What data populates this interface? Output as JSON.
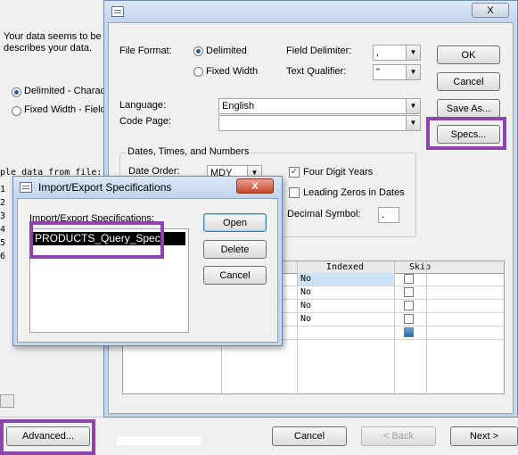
{
  "bg_wizard": {
    "description_lines": [
      "Your data seems to be i",
      "describes your data."
    ],
    "option_delimited": "Delimited - Characte",
    "option_fixed": "Fixed Width - Field",
    "sample_label": "ple data from file:",
    "row_numbers": [
      "1",
      "2",
      "3",
      "4",
      "5",
      "6"
    ],
    "advanced_label": "Advanced...",
    "cancel_label": "Cancel",
    "back_label": "< Back",
    "next_label": "Next >"
  },
  "spec_dialog": {
    "close_label": "X",
    "file_format_label": "File Format:",
    "format_delimited": "Delimited",
    "format_fixed": "Fixed Width",
    "field_delimiter_label": "Field Delimiter:",
    "field_delimiter_value": ",",
    "text_qualifier_label": "Text Qualifier:",
    "text_qualifier_value": "\"",
    "language_label": "Language:",
    "language_value": "English",
    "code_page_label": "Code Page:",
    "code_page_value": "",
    "ok_label": "OK",
    "cancel_label": "Cancel",
    "save_as_label": "Save As...",
    "specs_label": "Specs...",
    "dates_group_label": "Dates, Times, and Numbers",
    "date_order_label": "Date Order:",
    "date_order_value": "MDY",
    "four_digit_years": "Four Digit Years",
    "leading_zeros": "Leading Zeros in Dates",
    "decimal_symbol_label": "Decimal Symbol:",
    "decimal_symbol_value": ".",
    "grid_headers": [
      "Indexed",
      "Skip"
    ],
    "grid_rows": [
      {
        "indexed": "No",
        "skip": false
      },
      {
        "indexed": "No",
        "skip": false
      },
      {
        "indexed": "No",
        "skip": false
      },
      {
        "indexed": "No",
        "skip": false
      },
      {
        "indexed": "",
        "skip": true
      }
    ]
  },
  "ie_dialog": {
    "title": "Import/Export Specifications",
    "close_label": "X",
    "list_label": "Import/Export Specifications:",
    "items": [
      "PRODUCTS_Query_Spec"
    ],
    "open_label": "Open",
    "delete_label": "Delete",
    "cancel_label": "Cancel"
  },
  "colors": {
    "highlight": "#8e44ad",
    "selection": "#000000",
    "grid_selected": "#cde3f7"
  }
}
